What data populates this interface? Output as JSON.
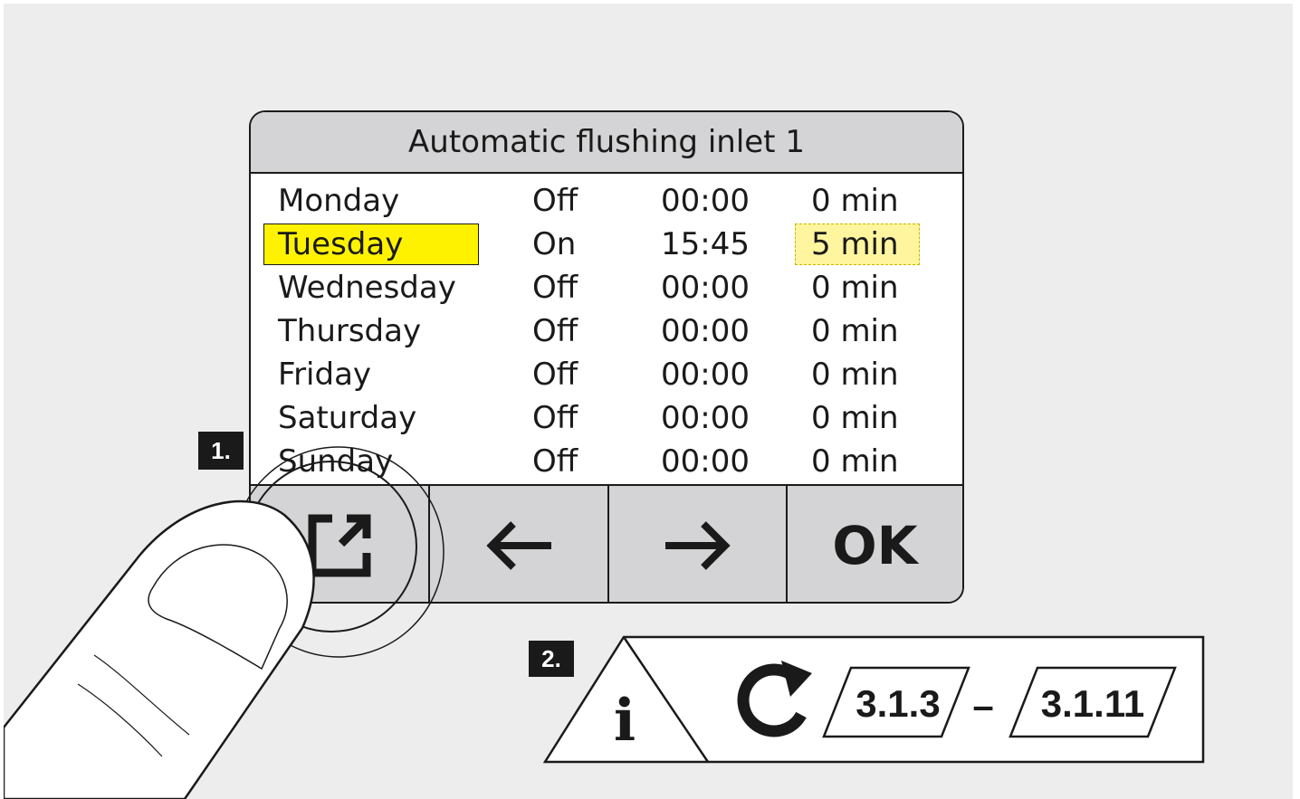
{
  "screen": {
    "title": "Automatic flushing inlet 1",
    "rows": [
      {
        "day": "Monday",
        "state": "Off",
        "time": "00:00",
        "duration": "0 min",
        "day_selected": false,
        "duration_selected": false
      },
      {
        "day": "Tuesday",
        "state": "On",
        "time": "15:45",
        "duration": "5 min",
        "day_selected": true,
        "duration_selected": true
      },
      {
        "day": "Wednesday",
        "state": "Off",
        "time": "00:00",
        "duration": "0 min",
        "day_selected": false,
        "duration_selected": false
      },
      {
        "day": "Thursday",
        "state": "Off",
        "time": "00:00",
        "duration": "0 min",
        "day_selected": false,
        "duration_selected": false
      },
      {
        "day": "Friday",
        "state": "Off",
        "time": "00:00",
        "duration": "0 min",
        "day_selected": false,
        "duration_selected": false
      },
      {
        "day": "Saturday",
        "state": "Off",
        "time": "00:00",
        "duration": "0 min",
        "day_selected": false,
        "duration_selected": false
      },
      {
        "day": "Sunday",
        "state": "Off",
        "time": "00:00",
        "duration": "0 min",
        "day_selected": false,
        "duration_selected": false
      }
    ],
    "buttons": {
      "edit_icon": "external-edit-icon",
      "back_icon": "arrow-left-icon",
      "forward_icon": "arrow-right-icon",
      "ok_label": "OK"
    }
  },
  "steps": {
    "step1_label": "1.",
    "step2_label": "2."
  },
  "info": {
    "info_icon": "info-icon",
    "info_glyph": "i",
    "refresh_icon": "refresh-icon",
    "ref_start": "3.1.3",
    "ref_separator": "–",
    "ref_end": "3.1.11"
  },
  "colors": {
    "day_highlight": "#fff200",
    "duration_highlight": "#fff59e",
    "bar_gray": "#d4d4d6",
    "background": "#ededed"
  }
}
